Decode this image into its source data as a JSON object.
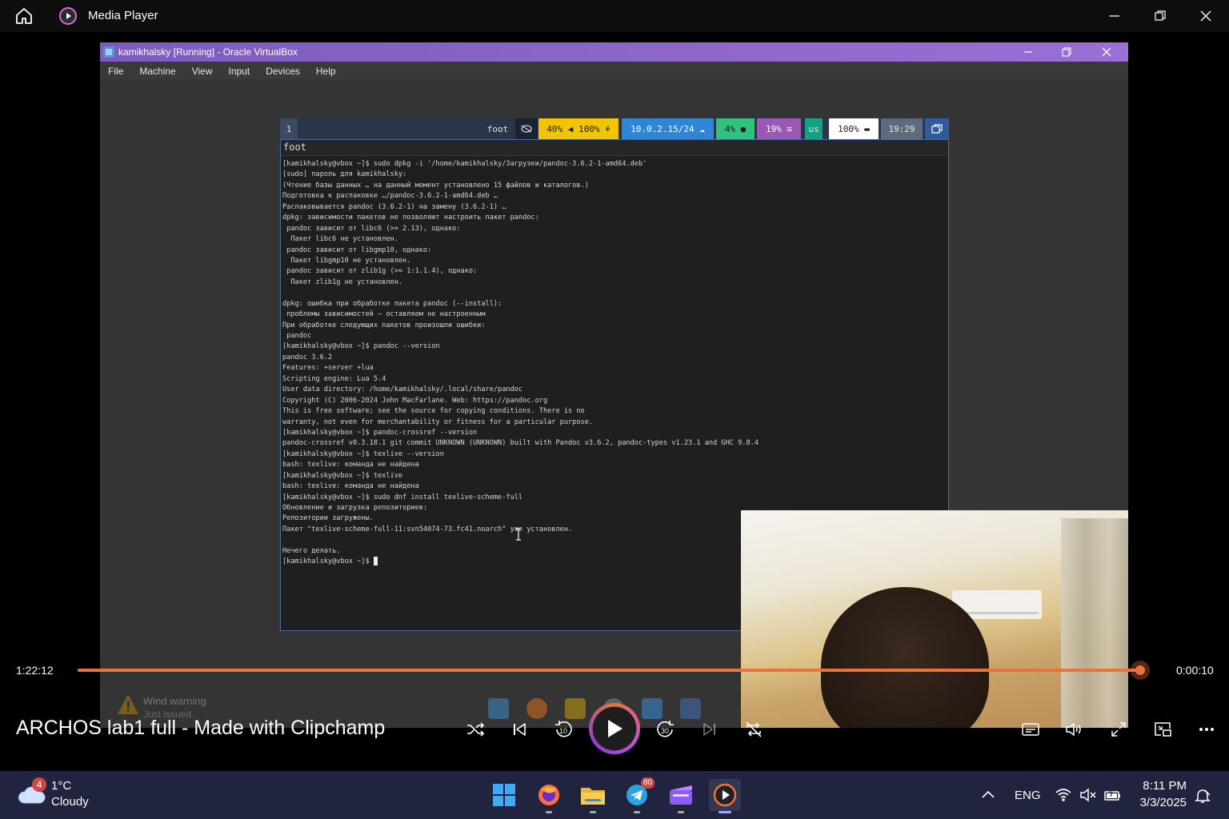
{
  "app": {
    "title": "Media Player"
  },
  "virtualbox": {
    "title": "kamikhalsky [Running] - Oracle VirtualBox",
    "menu": [
      "File",
      "Machine",
      "View",
      "Input",
      "Devices",
      "Help"
    ]
  },
  "waybar": {
    "workspace": "1",
    "window": "foot",
    "audio": "40% ◀ 100% ⚘",
    "network": "10.0.2.15/24 ☁",
    "cpu": "4% ●",
    "memory": "19% ≡",
    "layout": "us",
    "battery": "100% ▬",
    "time": "19:29"
  },
  "terminal": {
    "title": "foot",
    "lines": [
      "[kamikhalsky@vbox ~]$ sudo dpkg -i '/home/kamikhalsky/Загрузки/pandoc-3.6.2-1-amd64.deb'",
      "[sudo] пароль для kamikhalsky:",
      "(Чтение базы данных … на данный момент установлено 15 файлов и каталогов.)",
      "Подготовка к распаковке …/pandoc-3.6.2-1-amd64.deb …",
      "Распаковывается pandoc (3.6.2-1) на замену (3.6.2-1) …",
      "dpkg: зависимости пакетов не позволяют настроить пакет pandoc:",
      " pandoc зависит от libc6 (>= 2.13), однако:",
      "  Пакет libc6 не установлен.",
      " pandoc зависит от libgmp10, однако:",
      "  Пакет libgmp10 не установлен.",
      " pandoc зависит от zlib1g (>= 1:1.1.4), однако:",
      "  Пакет zlib1g не установлен.",
      "",
      "dpkg: ошибка при обработке пакета pandoc (--install):",
      " проблемы зависимостей — оставляем не настроенным",
      "При обработке следующих пакетов произошли ошибки:",
      " pandoc",
      "[kamikhalsky@vbox ~]$ pandoc --version",
      "pandoc 3.6.2",
      "Features: +server +lua",
      "Scripting engine: Lua 5.4",
      "User data directory: /home/kamikhalsky/.local/share/pandoc",
      "Copyright (C) 2006-2024 John MacFarlane. Web: https://pandoc.org",
      "This is free software; see the source for copying conditions. There is no",
      "warranty, not even for merchantability or fitness for a particular purpose.",
      "[kamikhalsky@vbox ~]$ pandoc-crossref --version",
      "pandoc-crossref v0.3.18.1 git commit UNKNOWN (UNKNOWN) built with Pandoc v3.6.2, pandoc-types v1.23.1 and GHC 9.8.4",
      "[kamikhalsky@vbox ~]$ texlive --version",
      "bash: texlive: команда не найдена",
      "[kamikhalsky@vbox ~]$ texlive",
      "bash: texlive: команда не найдена",
      "[kamikhalsky@vbox ~]$ sudo dnf install texlive-scheme-full",
      "Обновление и загрузка репозиториев:",
      "Репозитории загружены.",
      "Пакет \"texlive-scheme-full-11:svn54074-73.fc41.noarch\" уже установлен.",
      "",
      "Нечего делать.",
      "[kamikhalsky@vbox ~]$ "
    ]
  },
  "player": {
    "elapsed": "1:22:12",
    "remaining": "0:00:10",
    "progress": 0.9998,
    "media_title": "ARCHOS lab1 full - Made with Clipchamp",
    "accent": "#e8743b"
  },
  "ghost_widget": {
    "title": "Wind warning",
    "subtitle": "Just issued"
  },
  "taskbar": {
    "weather_badge": "4",
    "weather_temp": "1°C",
    "weather_desc": "Cloudy",
    "telegram_badge": "80",
    "language": "ENG",
    "time": "8:11 PM",
    "date": "3/3/2025"
  }
}
